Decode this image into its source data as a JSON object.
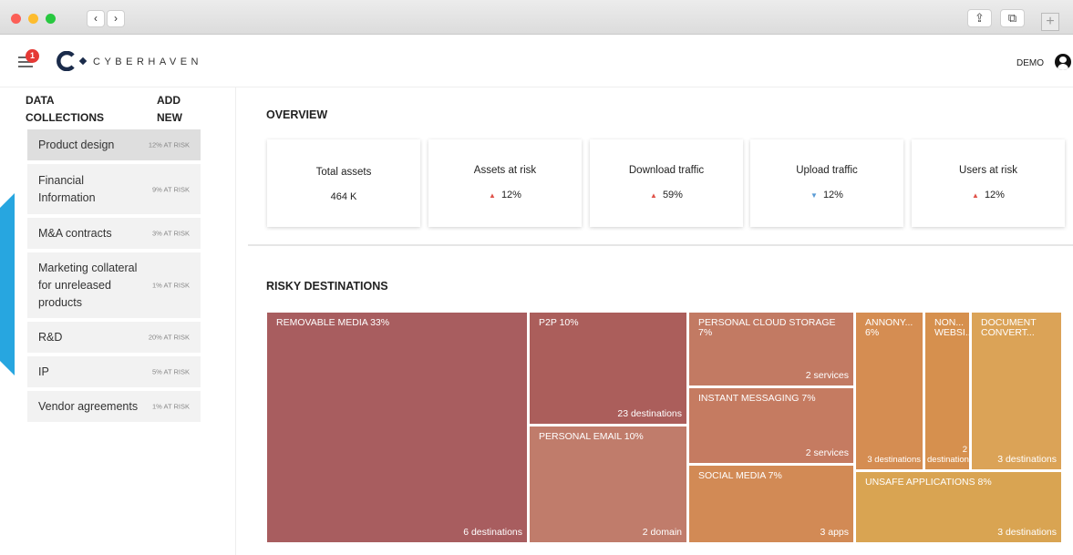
{
  "app": {
    "brand": "CYBERHAVEN",
    "notification_count": "1",
    "user_label": "DEMO"
  },
  "nav": {
    "back": "‹",
    "forward": "›",
    "share": "⇪",
    "tabs": "⧉",
    "new_tab": "+"
  },
  "sidebar": {
    "title": "DATA COLLECTIONS",
    "add_label": "ADD NEW",
    "items": [
      {
        "label": "Product design",
        "risk": "12% AT RISK"
      },
      {
        "label": "Financial Information",
        "risk": "9% AT RISK"
      },
      {
        "label": "M&A contracts",
        "risk": "3% AT RISK"
      },
      {
        "label": "Marketing collateral for unreleased products",
        "risk": "1% AT RISK"
      },
      {
        "label": "R&D",
        "risk": "20% AT RISK"
      },
      {
        "label": "IP",
        "risk": "5% AT RISK"
      },
      {
        "label": "Vendor agreements",
        "risk": "1% AT RISK"
      }
    ]
  },
  "overview": {
    "title": "OVERVIEW",
    "cards": [
      {
        "title": "Total assets",
        "value": "464 K",
        "arrow": "",
        "arrow_color": ""
      },
      {
        "title": "Assets at risk",
        "value": "12%",
        "arrow": "▲",
        "arrow_color": "#e0524a"
      },
      {
        "title": "Download traffic",
        "value": "59%",
        "arrow": "▲",
        "arrow_color": "#e0524a"
      },
      {
        "title": "Upload traffic",
        "value": "12%",
        "arrow": "▼",
        "arrow_color": "#5b9bd5"
      },
      {
        "title": "Users at risk",
        "value": "12%",
        "arrow": "▲",
        "arrow_color": "#e0524a"
      }
    ]
  },
  "risky": {
    "title": "RISKY DESTINATIONS",
    "tiles": [
      {
        "label": "REMOVABLE MEDIA 33%",
        "count": "6 destinations",
        "color": "#a85d5f"
      },
      {
        "label": "P2P 10%",
        "count": "23 destinations",
        "color": "#ab5e5b"
      },
      {
        "label": "PERSONAL EMAIL 10%",
        "count": "2 domain",
        "color": "#c07c6b"
      },
      {
        "label": "PERSONAL CLOUD STORAGE 7%",
        "count": "2 services",
        "color": "#c27a63"
      },
      {
        "label": "INSTANT MESSAGING 7%",
        "count": "2 services",
        "color": "#c57b61"
      },
      {
        "label": "SOCIAL MEDIA 7%",
        "count": "3 apps",
        "color": "#d28a55"
      },
      {
        "label": "ANNONY... 6%",
        "count": "3 destinations",
        "color": "#d58d52"
      },
      {
        "label": "NON... WEBSI...",
        "count": "2 destinations",
        "color": "#d6904e"
      },
      {
        "label": "DOCUMENT CONVERT...",
        "count": "3 destinations",
        "color": "#dba357"
      },
      {
        "label": "UNSAFE APPLICATIONS 8%",
        "count": "3 destinations",
        "color": "#d9a452"
      }
    ]
  }
}
